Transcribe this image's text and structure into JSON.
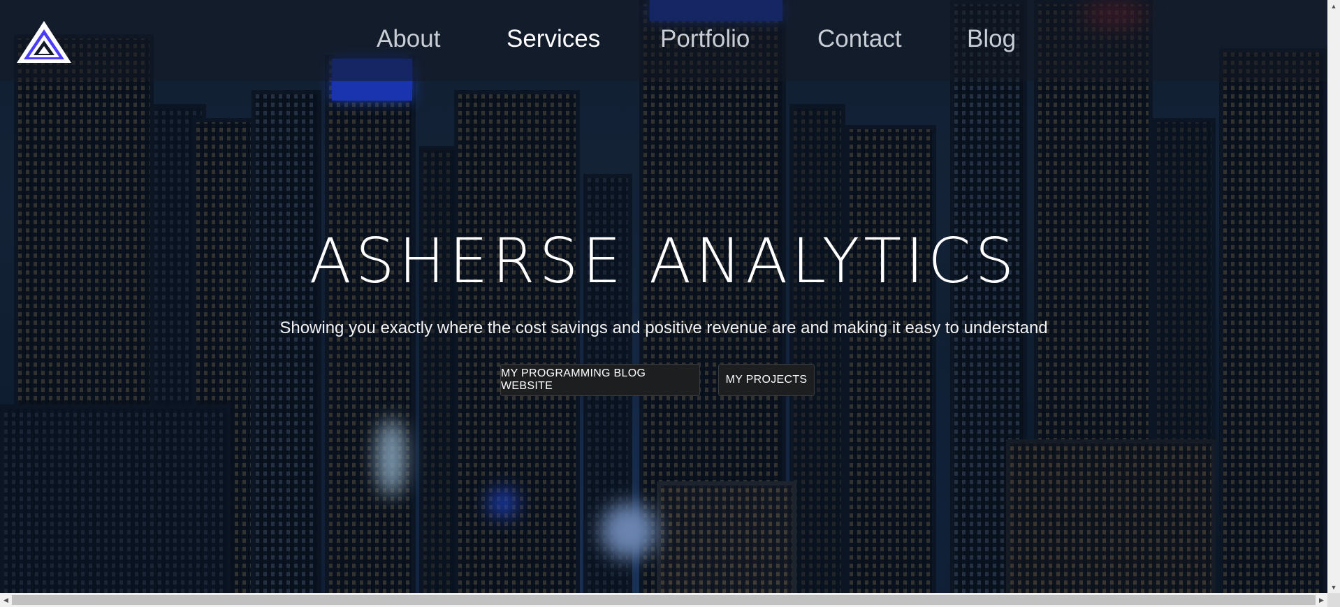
{
  "nav": {
    "logo_icon": "asherse-triangle-logo-icon",
    "items": [
      {
        "label": "About",
        "active": false
      },
      {
        "label": "Services",
        "active": true
      },
      {
        "label": "Portfolio",
        "active": false
      },
      {
        "label": "Contact",
        "active": false
      },
      {
        "label": "Blog",
        "active": false
      }
    ]
  },
  "hero": {
    "title": "ASHERSE ANALYTICS",
    "subtitle": "Showing you exactly where the cost savings and positive revenue are and making it easy to understand",
    "buttons": [
      {
        "label": "MY PROGRAMMING BLOG WEBSITE"
      },
      {
        "label": "MY PROJECTS"
      }
    ],
    "background": "night-city-skyline-image"
  },
  "colors": {
    "logo_accent": "#4a3cff",
    "nav_text": "#c9ced6",
    "nav_active": "#ffffff",
    "button_bg": "#1d1e20"
  }
}
